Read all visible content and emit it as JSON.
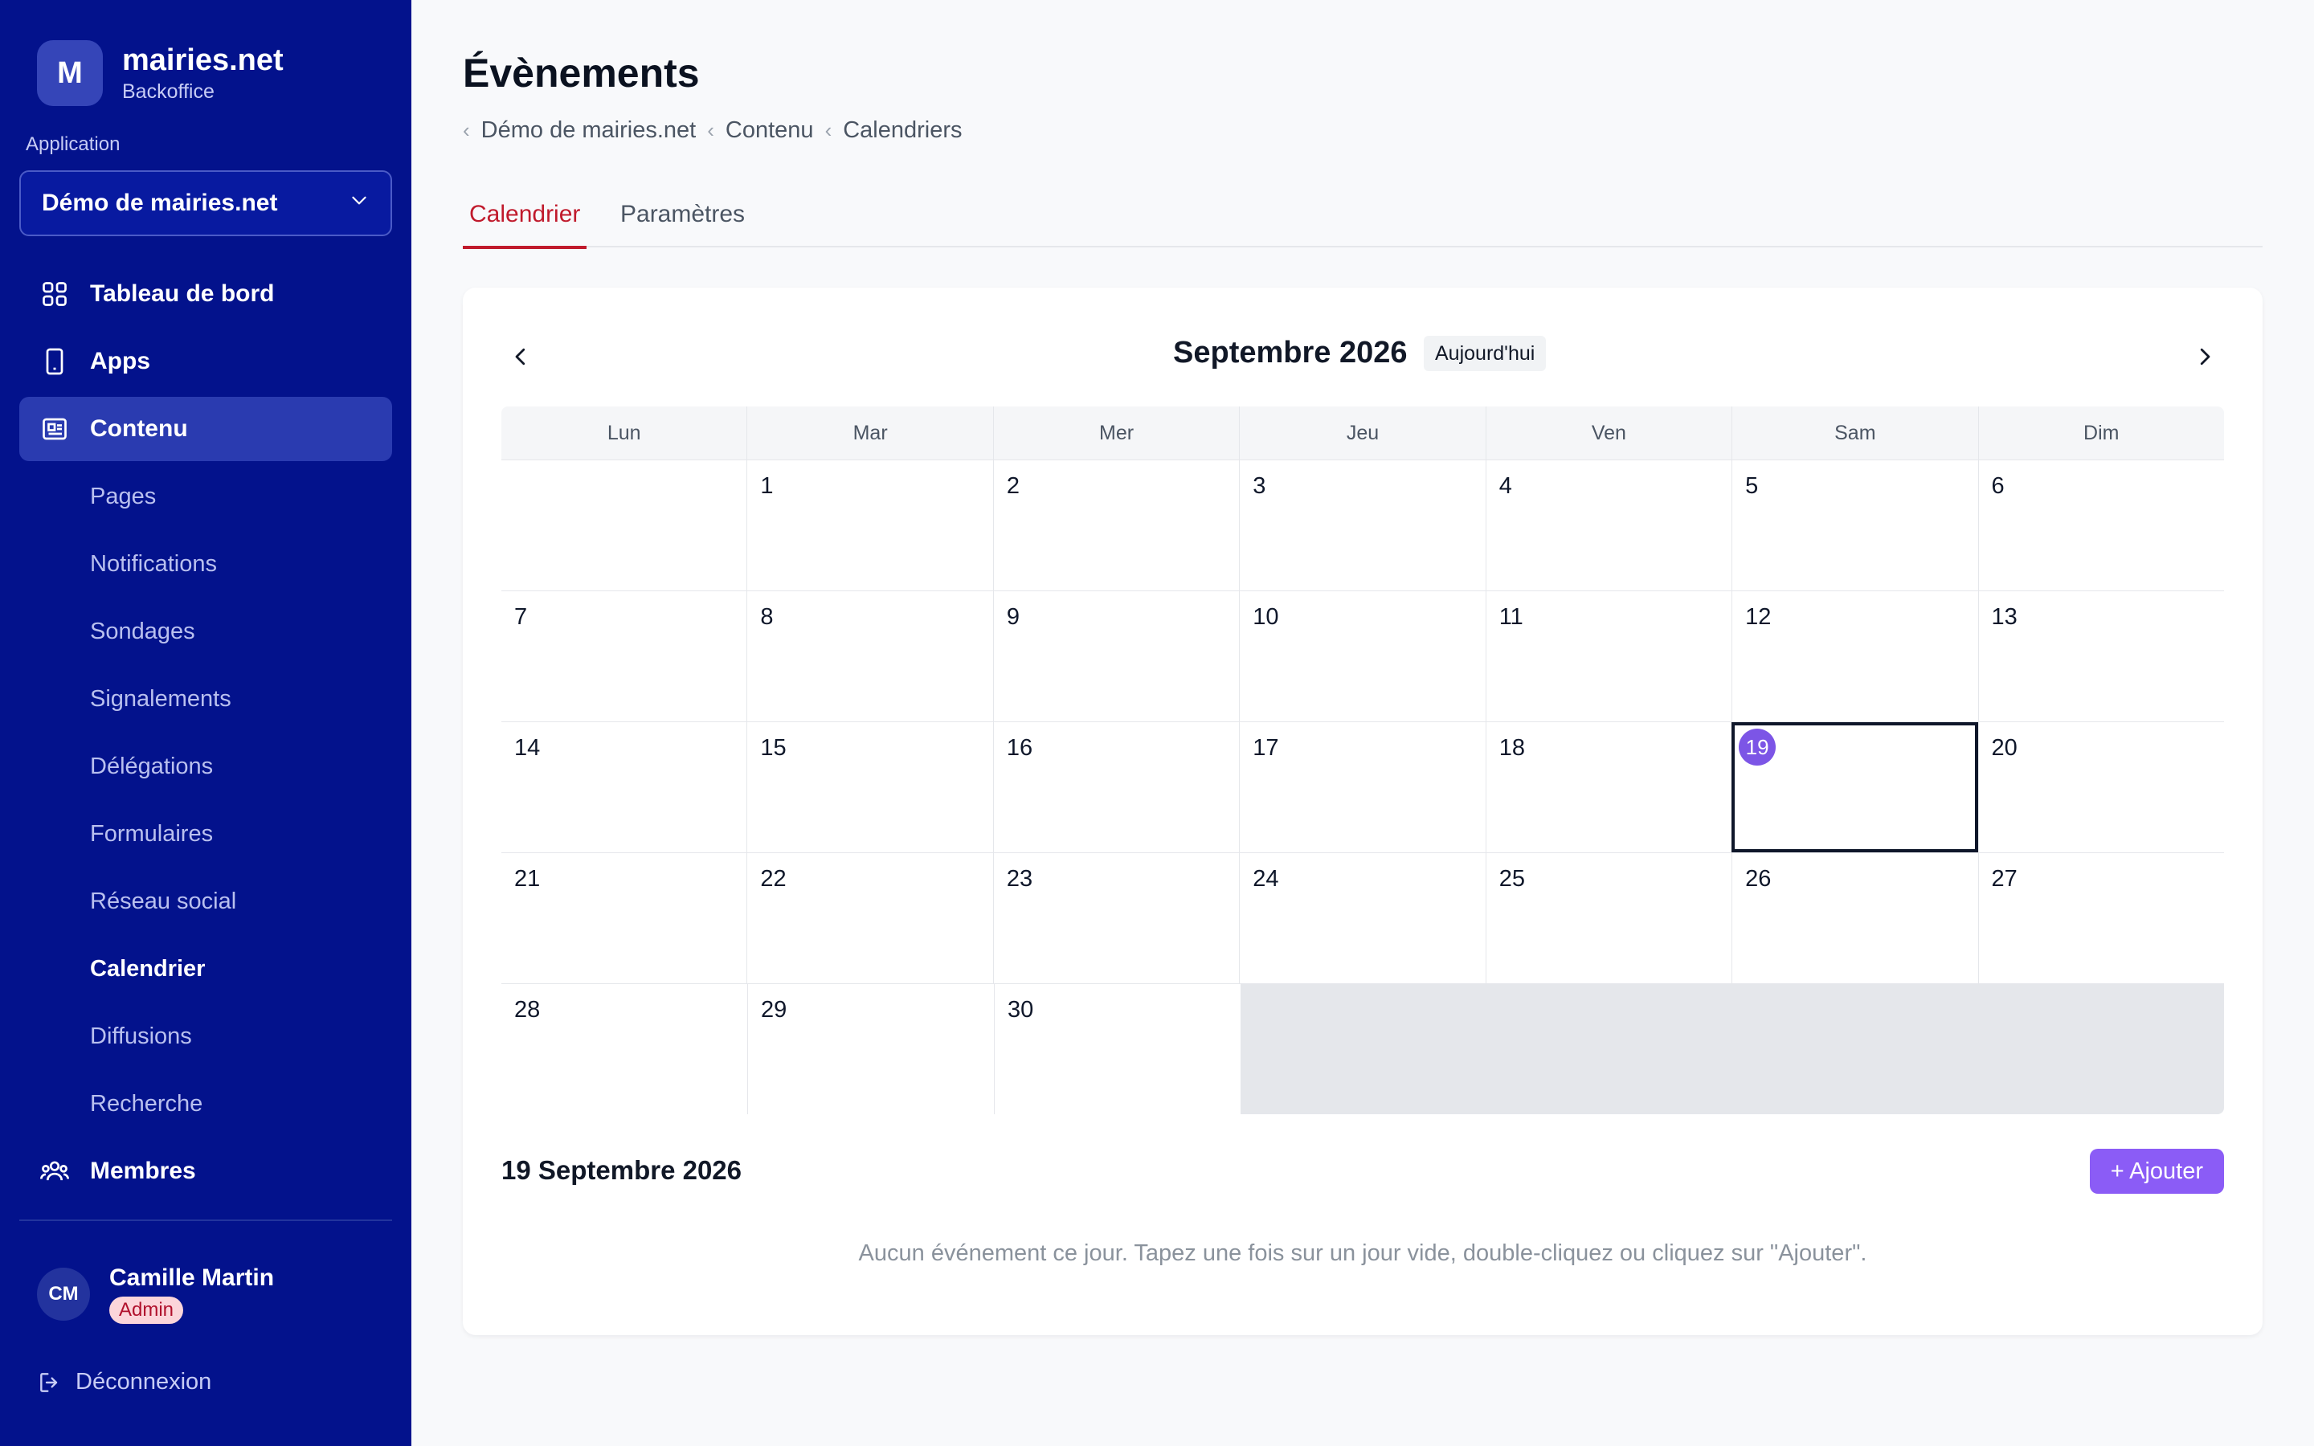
{
  "brand": {
    "logo_letter": "M",
    "name": "mairies.net",
    "subtitle": "Backoffice"
  },
  "application": {
    "label": "Application",
    "selected": "Démo de mairies.net"
  },
  "nav": {
    "dashboard": "Tableau de bord",
    "apps": "Apps",
    "content": "Contenu",
    "content_items": [
      "Pages",
      "Notifications",
      "Sondages",
      "Signalements",
      "Délégations",
      "Formulaires",
      "Réseau social",
      "Calendrier",
      "Diffusions",
      "Recherche"
    ],
    "current_sub": "Calendrier",
    "members": "Membres"
  },
  "user": {
    "initials": "CM",
    "name": "Camille Martin",
    "role": "Admin"
  },
  "logout": "Déconnexion",
  "page": {
    "title": "Évènements",
    "breadcrumbs": [
      "Démo de mairies.net",
      "Contenu",
      "Calendriers"
    ],
    "tabs": [
      "Calendrier",
      "Paramètres"
    ],
    "active_tab": "Calendrier"
  },
  "calendar": {
    "month_title": "Septembre 2026",
    "today_label": "Aujourd'hui",
    "weekdays": [
      "Lun",
      "Mar",
      "Mer",
      "Jeu",
      "Ven",
      "Sam",
      "Dim"
    ],
    "weeks": [
      [
        "",
        "1",
        "2",
        "3",
        "4",
        "5",
        "6"
      ],
      [
        "7",
        "8",
        "9",
        "10",
        "11",
        "12",
        "13"
      ],
      [
        "14",
        "15",
        "16",
        "17",
        "18",
        "19",
        "20"
      ],
      [
        "21",
        "22",
        "23",
        "24",
        "25",
        "26",
        "27"
      ],
      [
        "28",
        "29",
        "30",
        null,
        null,
        null,
        null
      ]
    ],
    "selected_day": "19",
    "selected_date_label": "19 Septembre 2026",
    "add_label": "+ Ajouter",
    "empty_message": "Aucun événement ce jour. Tapez une fois sur un jour vide, double-cliquez ou cliquez sur \"Ajouter\"."
  },
  "colors": {
    "sidebar": "#03128c",
    "active_tab": "#c01a2c",
    "accent": "#8b5cf6",
    "selected_day": "#7c55e6"
  }
}
